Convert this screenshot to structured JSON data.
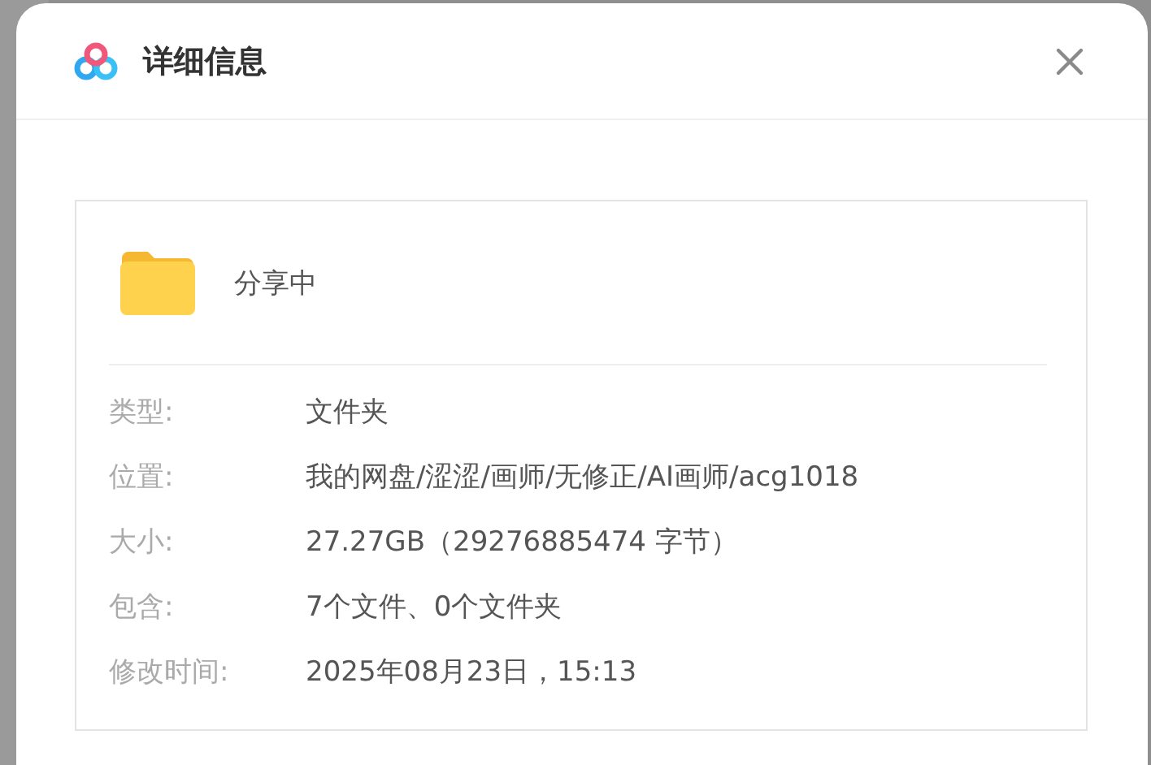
{
  "dialog": {
    "title": "详细信息"
  },
  "item": {
    "name": "分享中"
  },
  "details": [
    {
      "label": "类型:",
      "value": "文件夹"
    },
    {
      "label": "位置:",
      "value": "我的网盘/涩涩/画师/无修正/AI画师/acg1018"
    },
    {
      "label": "大小:",
      "value": "27.27GB（29276885474 字节）"
    },
    {
      "label": "包含:",
      "value": "7个文件、0个文件夹"
    },
    {
      "label": "修改时间:",
      "value": "2025年08月23日，15:13"
    }
  ]
}
